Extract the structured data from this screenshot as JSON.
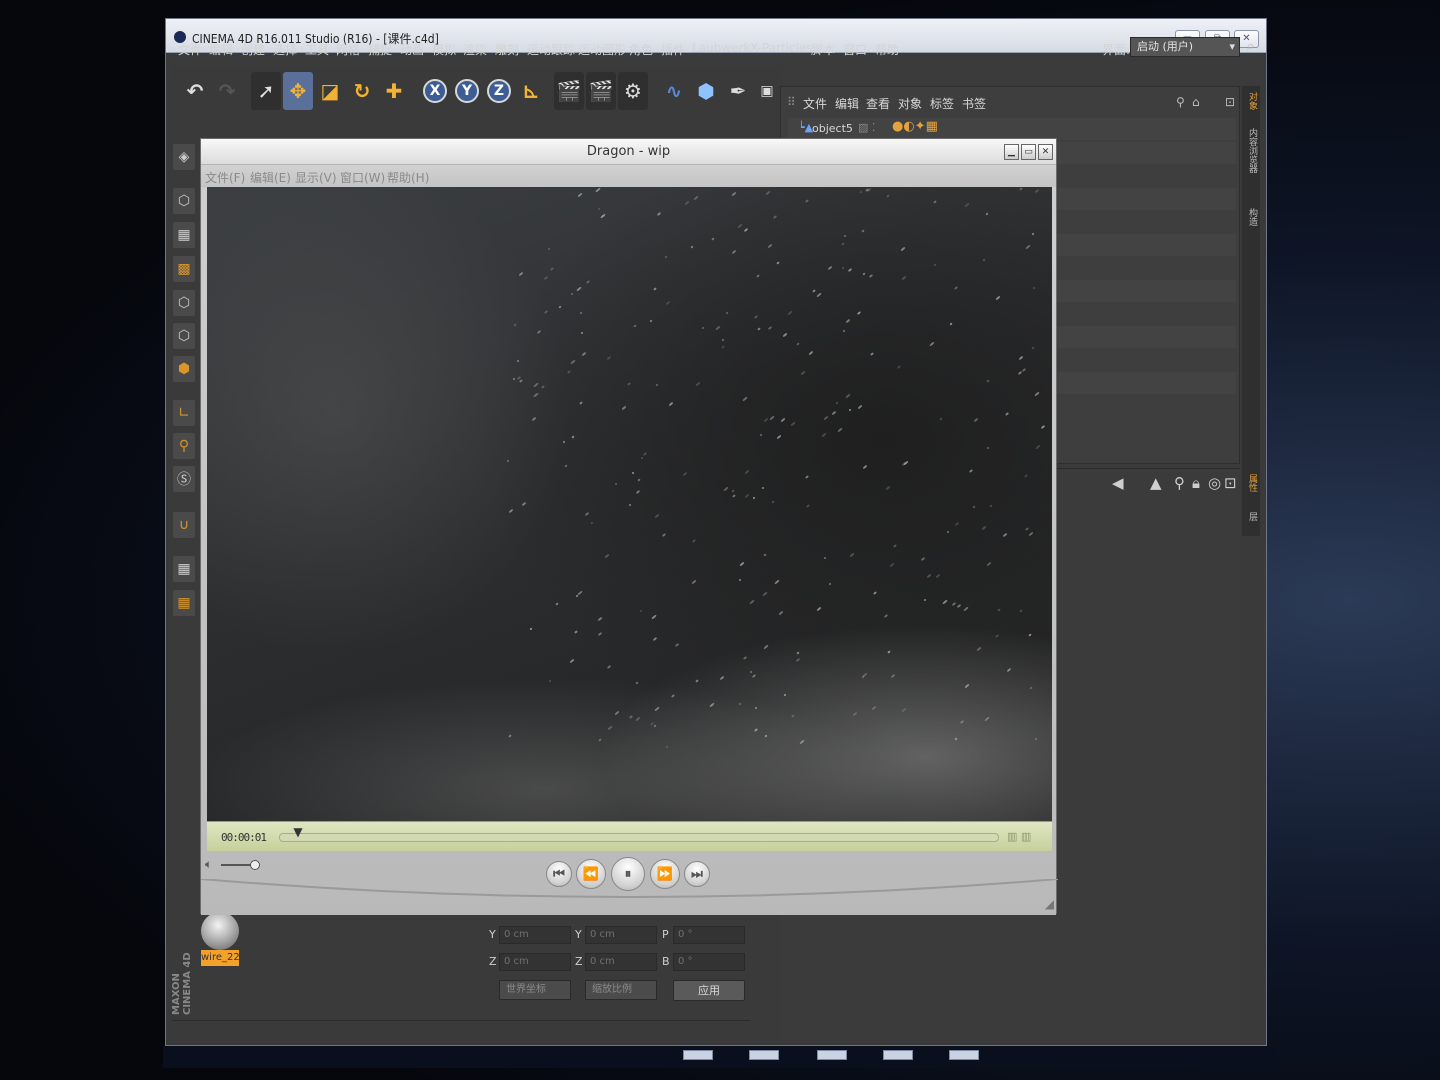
{
  "c4d": {
    "window_title": "CINEMA 4D R16.011 Studio (R16) - [课件.c4d]",
    "window_buttons": [
      "▭",
      "⧉",
      "✕"
    ],
    "menus": [
      "文件",
      "编辑",
      "创建",
      "选择",
      "工具",
      "网格",
      "捕捉",
      "动画",
      "模拟",
      "渲染",
      "雕刻",
      "运动跟踪",
      "运动图形",
      "角色",
      "插件",
      "Laubwerk",
      "X-Particles",
      "脚本",
      "窗口",
      "帮助"
    ],
    "interface_label": "界面:",
    "interface_value": "启动 (用户)",
    "object_manager": {
      "menus": [
        "文件",
        "编辑",
        "查看",
        "对象",
        "标签",
        "书签"
      ],
      "object_name": "object5"
    },
    "right_tabs": [
      "对象",
      "内容浏览器",
      "构造"
    ],
    "attr_tabs": [
      "属性",
      "层"
    ],
    "coordinates": {
      "rows": [
        {
          "axis1": "Y",
          "v1": "0 cm",
          "axis2": "Y",
          "v2": "0 cm",
          "axis3": "P",
          "v3": "0 °"
        },
        {
          "axis1": "Z",
          "v1": "0 cm",
          "axis2": "Z",
          "v2": "0 cm",
          "axis3": "B",
          "v3": "0 °"
        }
      ],
      "dropdown1": "世界坐标",
      "dropdown2": "缩放比例",
      "apply": "应用"
    },
    "material_label": "wire_22",
    "maxon_logo": "MAXON CINEMA 4D"
  },
  "player": {
    "title": "Dragon - wip",
    "menus": [
      "文件(F)",
      "编辑(E)",
      "显示(V)",
      "窗口(W)",
      "帮助(H)"
    ],
    "timecode": "00:00:01",
    "playhead_fraction": 0.02,
    "volume_fraction": 1.0
  }
}
